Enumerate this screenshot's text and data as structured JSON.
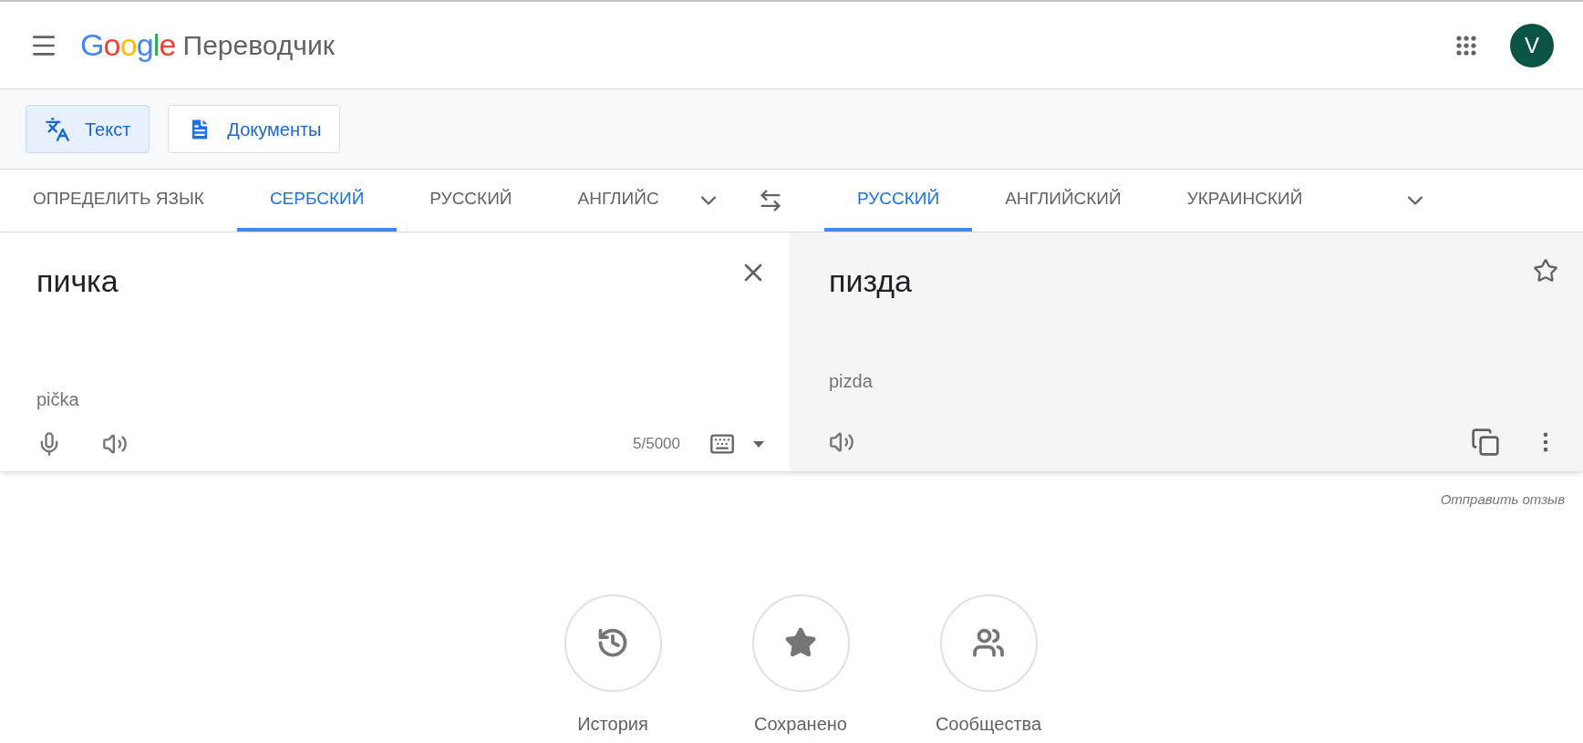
{
  "header": {
    "logo": "Google",
    "product": "Переводчик",
    "avatar": "V"
  },
  "modes": [
    {
      "label": "Текст",
      "kind": "text",
      "selected": true
    },
    {
      "label": "Документы",
      "kind": "docs",
      "selected": false
    }
  ],
  "source_langs": [
    {
      "label": "ОПРЕДЕЛИТЬ ЯЗЫК",
      "selected": false
    },
    {
      "label": "СЕРБСКИЙ",
      "selected": true
    },
    {
      "label": "РУССКИЙ",
      "selected": false
    },
    {
      "label": "АНГЛИЙС",
      "selected": false
    }
  ],
  "target_langs": [
    {
      "label": "РУССКИЙ",
      "selected": true
    },
    {
      "label": "АНГЛИЙСКИЙ",
      "selected": false
    },
    {
      "label": "УКРАИНСКИЙ",
      "selected": false
    }
  ],
  "source": {
    "text": "пичка",
    "transliteration": "pička",
    "count": "5/5000"
  },
  "target": {
    "text": "пизда",
    "transliteration": "pizda"
  },
  "feedback": "Отправить отзыв",
  "shortcuts": [
    {
      "label": "История",
      "kind": "history"
    },
    {
      "label": "Сохранено",
      "kind": "saved"
    },
    {
      "label": "Сообщества",
      "kind": "community"
    }
  ]
}
